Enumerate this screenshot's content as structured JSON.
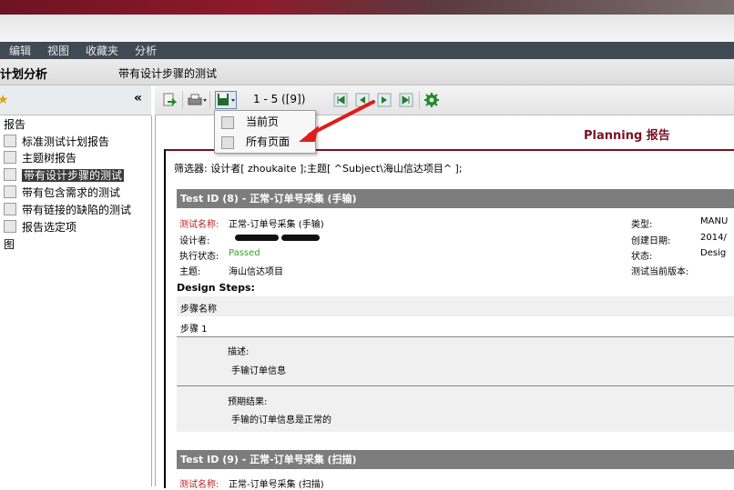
{
  "menu": [
    "编辑",
    "视图",
    "收藏夹",
    "分析"
  ],
  "title": {
    "module": "计划分析",
    "page": "带有设计步骤的测试"
  },
  "left": {
    "collapse": "«",
    "items": [
      {
        "label": "报告",
        "icon": false
      },
      {
        "label": "标准测试计划报告",
        "icon": true
      },
      {
        "label": "主题树报告",
        "icon": true
      },
      {
        "label": "带有设计步骤的测试",
        "icon": true,
        "selected": true
      },
      {
        "label": "带有包含需求的测试",
        "icon": true
      },
      {
        "label": "带有链接的缺陷的测试",
        "icon": true
      },
      {
        "label": "报告选定项",
        "icon": true
      },
      {
        "label": "图",
        "icon": false
      }
    ]
  },
  "toolbar": {
    "pager": "1 - 5 ([9])"
  },
  "dropdown": {
    "current": "当前页",
    "all": "所有页面"
  },
  "report": {
    "title": "Planning 报告",
    "filter": "筛选器: 设计者[ zhoukaite ];主题[ ^Subject\\海山信达项目^ ];",
    "t8": {
      "header": "Test ID (8) - 正常-订单号采集 (手输)",
      "name_label": "测试名称:",
      "name": "正常-订单号采集 (手输)",
      "designer_label": "设计者:",
      "status_label": "执行状态:",
      "status": "Passed",
      "subject_label": "主题:",
      "subject": "海山信达项目",
      "type_label": "类型:",
      "type": "MANU",
      "date_label": "创建日期:",
      "date": "2014/",
      "state_label": "状态:",
      "state": "Desig",
      "version_label": "测试当前版本:",
      "steps_title": "Design Steps:",
      "step_col": "步骤名称",
      "step1": "步骤 1",
      "desc_label": "描述:",
      "desc": "手输订单信息",
      "exp_label": "预期结果:",
      "exp": "手输的订单信息是正常的"
    },
    "t9": {
      "header": "Test ID (9) - 正常-订单号采集 (扫描)",
      "name_label": "测试名称:",
      "name": "正常-订单号采集 (扫描)"
    }
  }
}
